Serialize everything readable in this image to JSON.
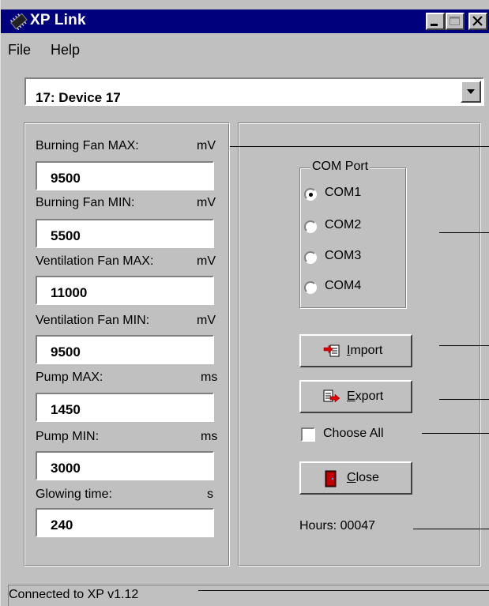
{
  "window": {
    "title": "XP Link",
    "controls": [
      "minimize",
      "maximize",
      "close"
    ],
    "colors": {
      "titlebar": "#00007c",
      "face": "#c0c0c0"
    }
  },
  "menu": {
    "items": [
      "File",
      "Help"
    ]
  },
  "device_select": {
    "value": "17: Device 17"
  },
  "params": [
    {
      "label": "Burning Fan MAX:",
      "unit": "mV",
      "value": "9500"
    },
    {
      "label": "Burning Fan MIN:",
      "unit": "mV",
      "value": "5500"
    },
    {
      "label": "Ventilation Fan MAX:",
      "unit": "mV",
      "value": "11000"
    },
    {
      "label": "Ventilation Fan MIN:",
      "unit": "mV",
      "value": "9500"
    },
    {
      "label": "Pump MAX:",
      "unit": "ms",
      "value": "1450"
    },
    {
      "label": "Pump MIN:",
      "unit": "ms",
      "value": "3000"
    },
    {
      "label": "Glowing time:",
      "unit": "s",
      "value": "240"
    }
  ],
  "com_port": {
    "title": "COM Port",
    "options": [
      "COM1",
      "COM2",
      "COM3",
      "COM4"
    ],
    "selected": "COM1"
  },
  "buttons": {
    "import": {
      "accel": "I",
      "rest": "mport",
      "icon": "import-icon"
    },
    "export": {
      "accel": "E",
      "rest": "xport",
      "icon": "export-icon"
    },
    "close": {
      "accel": "C",
      "rest": "lose",
      "icon": "door-icon"
    }
  },
  "choose_all": {
    "label": "Choose All",
    "checked": false
  },
  "hours": "Hours: 00047",
  "status": "Connected to XP v1.12"
}
